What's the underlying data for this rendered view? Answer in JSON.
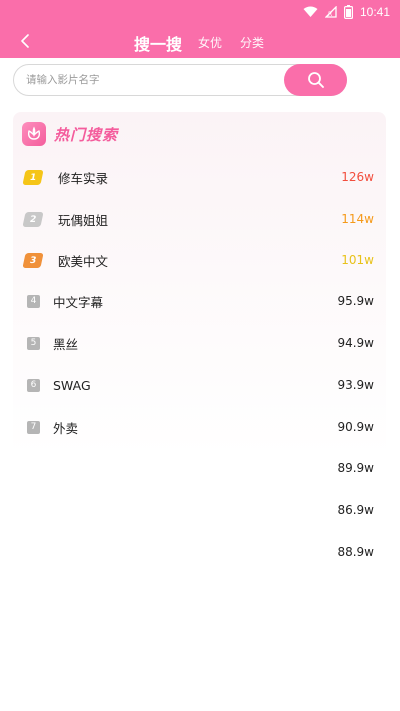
{
  "status_bar": {
    "wifi_icon": "wifi-icon",
    "signal_icon": "signal-icon",
    "battery_icon": "battery-icon",
    "time": "10:41"
  },
  "header": {
    "back_icon": "chevron-left-icon",
    "tabs": [
      {
        "label": "搜一搜",
        "active": true
      },
      {
        "label": "女优",
        "active": false
      },
      {
        "label": "分类",
        "active": false
      }
    ]
  },
  "search": {
    "placeholder": "请输入影片名字",
    "value": "",
    "button_icon": "search-icon"
  },
  "hot": {
    "logo_icon": "flower-icon",
    "title": "热门搜索",
    "items": [
      {
        "rank": "1",
        "name": "修车实录",
        "count": "126w",
        "color": "#f24e3e"
      },
      {
        "rank": "2",
        "name": "玩偶姐姐",
        "count": "114w",
        "color": "#f59a1a"
      },
      {
        "rank": "3",
        "name": "欧美中文",
        "count": "101w",
        "color": "#e8c21a"
      },
      {
        "rank": "4",
        "name": "中文字幕",
        "count": "95.9w"
      },
      {
        "rank": "5",
        "name": "黑丝",
        "count": "94.9w"
      },
      {
        "rank": "6",
        "name": "SWAG",
        "count": "93.9w"
      },
      {
        "rank": "7",
        "name": "外卖",
        "count": "90.9w"
      }
    ],
    "extra_counts": [
      "89.9w",
      "86.9w",
      "88.9w"
    ]
  },
  "colors": {
    "brand": "#fa6eaa",
    "badge_1": "#f5c518",
    "badge_2": "#c8c8c8",
    "badge_3": "#f0913a",
    "badge_other": "#b5b5b5"
  }
}
